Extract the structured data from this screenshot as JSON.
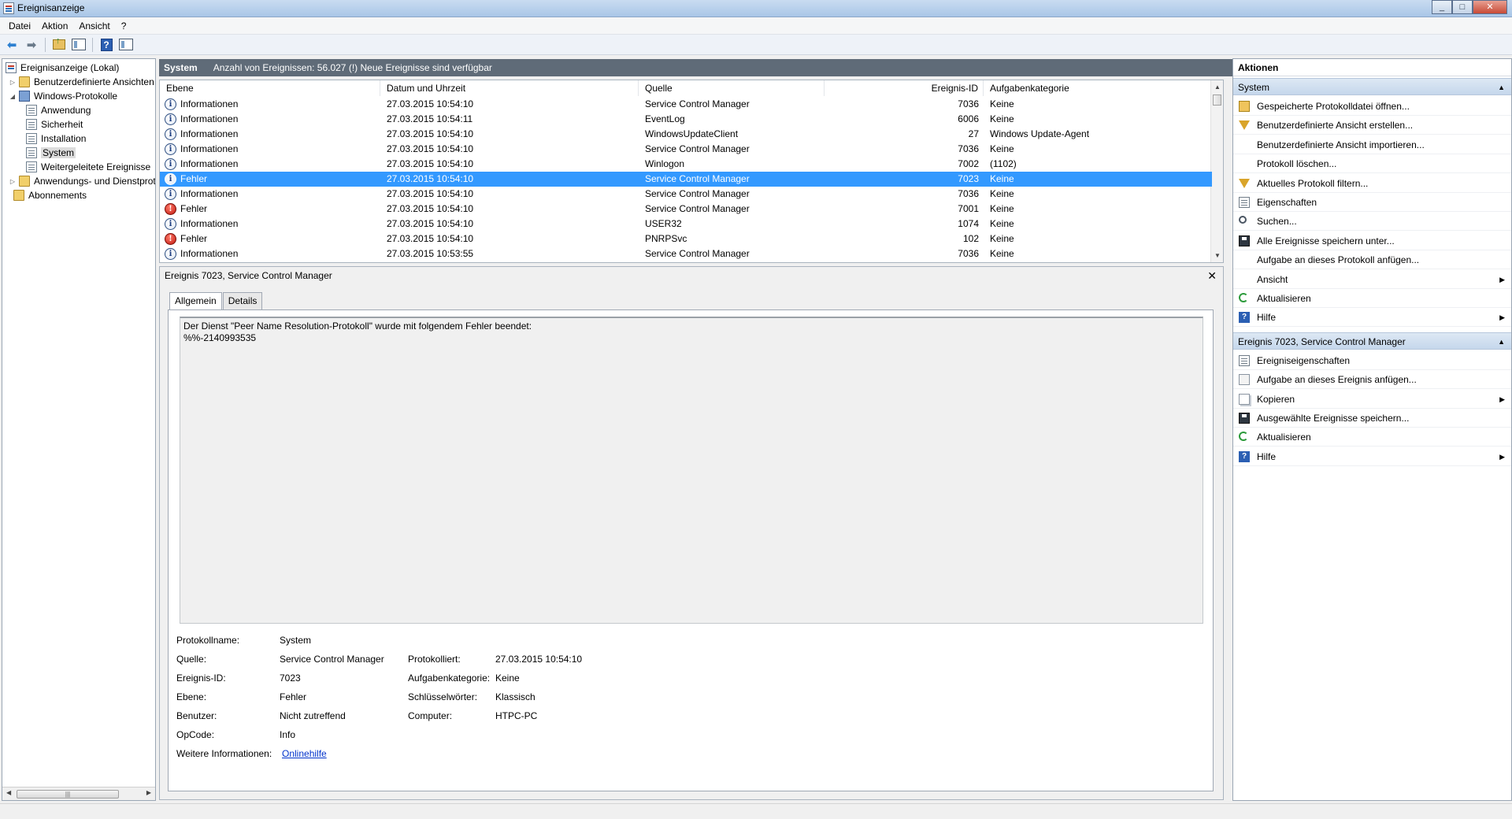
{
  "window": {
    "title": "Ereignisanzeige",
    "min": "_",
    "max": "□",
    "close": "✕"
  },
  "menu": [
    "Datei",
    "Aktion",
    "Ansicht",
    "?"
  ],
  "tree": [
    {
      "label": "Ereignisanzeige (Lokal)",
      "icon": "event-viewer-icon"
    },
    {
      "label": "Benutzerdefinierte Ansichten",
      "icon": "folder-icon",
      "expander": "▷"
    },
    {
      "label": "Windows-Protokolle",
      "icon": "logs-folder-icon",
      "expander": "◢"
    },
    {
      "label": "Anwendung",
      "icon": "log-icon"
    },
    {
      "label": "Sicherheit",
      "icon": "log-icon"
    },
    {
      "label": "Installation",
      "icon": "log-icon"
    },
    {
      "label": "System",
      "icon": "log-icon",
      "selected": true
    },
    {
      "label": "Weitergeleitete Ereignisse",
      "icon": "log-icon"
    },
    {
      "label": "Anwendungs- und Dienstprotokolle",
      "icon": "folder-icon",
      "expander": "▷"
    },
    {
      "label": "Abonnements",
      "icon": "folder-icon"
    }
  ],
  "center_header": {
    "title": "System",
    "info": "Anzahl von Ereignissen: 56.027 (!) Neue Ereignisse sind verfügbar"
  },
  "table": {
    "columns": [
      "Ebene",
      "Datum und Uhrzeit",
      "Quelle",
      "Ereignis-ID",
      "Aufgabenkategorie"
    ],
    "rows": [
      {
        "level": "Informationen",
        "type": "info",
        "date": "27.03.2015 10:54:10",
        "source": "Service Control Manager",
        "id": "7036",
        "category": "Keine"
      },
      {
        "level": "Informationen",
        "type": "info",
        "date": "27.03.2015 10:54:11",
        "source": "EventLog",
        "id": "6006",
        "category": "Keine"
      },
      {
        "level": "Informationen",
        "type": "info",
        "date": "27.03.2015 10:54:10",
        "source": "WindowsUpdateClient",
        "id": "27",
        "category": "Windows Update-Agent"
      },
      {
        "level": "Informationen",
        "type": "info",
        "date": "27.03.2015 10:54:10",
        "source": "Service Control Manager",
        "id": "7036",
        "category": "Keine"
      },
      {
        "level": "Informationen",
        "type": "info",
        "date": "27.03.2015 10:54:10",
        "source": "Winlogon",
        "id": "7002",
        "category": "(1102)"
      },
      {
        "level": "Fehler",
        "type": "info",
        "date": "27.03.2015 10:54:10",
        "source": "Service Control Manager",
        "id": "7023",
        "category": "Keine",
        "selected": true
      },
      {
        "level": "Informationen",
        "type": "info",
        "date": "27.03.2015 10:54:10",
        "source": "Service Control Manager",
        "id": "7036",
        "category": "Keine"
      },
      {
        "level": "Fehler",
        "type": "error",
        "date": "27.03.2015 10:54:10",
        "source": "Service Control Manager",
        "id": "7001",
        "category": "Keine"
      },
      {
        "level": "Informationen",
        "type": "info",
        "date": "27.03.2015 10:54:10",
        "source": "USER32",
        "id": "1074",
        "category": "Keine"
      },
      {
        "level": "Fehler",
        "type": "error",
        "date": "27.03.2015 10:54:10",
        "source": "PNRPSvc",
        "id": "102",
        "category": "Keine"
      },
      {
        "level": "Informationen",
        "type": "info",
        "date": "27.03.2015 10:53:55",
        "source": "Service Control Manager",
        "id": "7036",
        "category": "Keine"
      }
    ]
  },
  "detail": {
    "title": "Ereignis 7023, Service Control Manager",
    "tabs": [
      "Allgemein",
      "Details"
    ],
    "description_line1": "Der Dienst \"Peer Name Resolution-Protokoll\" wurde mit folgendem Fehler beendet:",
    "description_line2": "%%-2140993535",
    "props": {
      "logname_label": "Protokollname:",
      "logname": "System",
      "source_label": "Quelle:",
      "source": "Service Control Manager",
      "logged_label": "Protokolliert:",
      "logged": "27.03.2015 10:54:10",
      "eventid_label": "Ereignis-ID:",
      "eventid": "7023",
      "category_label": "Aufgabenkategorie:",
      "category": "Keine",
      "level_label": "Ebene:",
      "level": "Fehler",
      "keywords_label": "Schlüsselwörter:",
      "keywords": "Klassisch",
      "user_label": "Benutzer:",
      "user": "Nicht zutreffend",
      "computer_label": "Computer:",
      "computer": "HTPC-PC",
      "opcode_label": "OpCode:",
      "opcode": "Info",
      "moreinfo_label": "Weitere Informationen:",
      "moreinfo_link": "Onlinehilfe"
    }
  },
  "actions": {
    "title": "Aktionen",
    "section1": "System",
    "items1": [
      {
        "label": "Gespeicherte Protokolldatei öffnen...",
        "icon": "open-folder-icon"
      },
      {
        "label": "Benutzerdefinierte Ansicht erstellen...",
        "icon": "filter-icon"
      },
      {
        "label": "Benutzerdefinierte Ansicht importieren...",
        "icon": ""
      },
      {
        "label": "Protokoll löschen...",
        "icon": ""
      },
      {
        "label": "Aktuelles Protokoll filtern...",
        "icon": "filter-icon"
      },
      {
        "label": "Eigenschaften",
        "icon": "properties-icon"
      },
      {
        "label": "Suchen...",
        "icon": "find-icon"
      },
      {
        "label": "Alle Ereignisse speichern unter...",
        "icon": "save-icon"
      },
      {
        "label": "Aufgabe an dieses Protokoll anfügen...",
        "icon": ""
      },
      {
        "label": "Ansicht",
        "icon": "",
        "submenu": true
      },
      {
        "label": "Aktualisieren",
        "icon": "refresh-icon"
      },
      {
        "label": "Hilfe",
        "icon": "help-icon",
        "submenu": true
      }
    ],
    "section2": "Ereignis 7023, Service Control Manager",
    "items2": [
      {
        "label": "Ereigniseigenschaften",
        "icon": "properties-icon"
      },
      {
        "label": "Aufgabe an dieses Ereignis anfügen...",
        "icon": "task-icon"
      },
      {
        "label": "Kopieren",
        "icon": "copy-icon",
        "submenu": true
      },
      {
        "label": "Ausgewählte Ereignisse speichern...",
        "icon": "save-icon"
      },
      {
        "label": "Aktualisieren",
        "icon": "refresh-icon"
      },
      {
        "label": "Hilfe",
        "icon": "help-icon",
        "submenu": true
      }
    ]
  },
  "colors": {
    "selection": "#3399ff",
    "header_bar": "#5f6b78",
    "section_header": "#c5d7ec",
    "link": "#0033cc"
  }
}
